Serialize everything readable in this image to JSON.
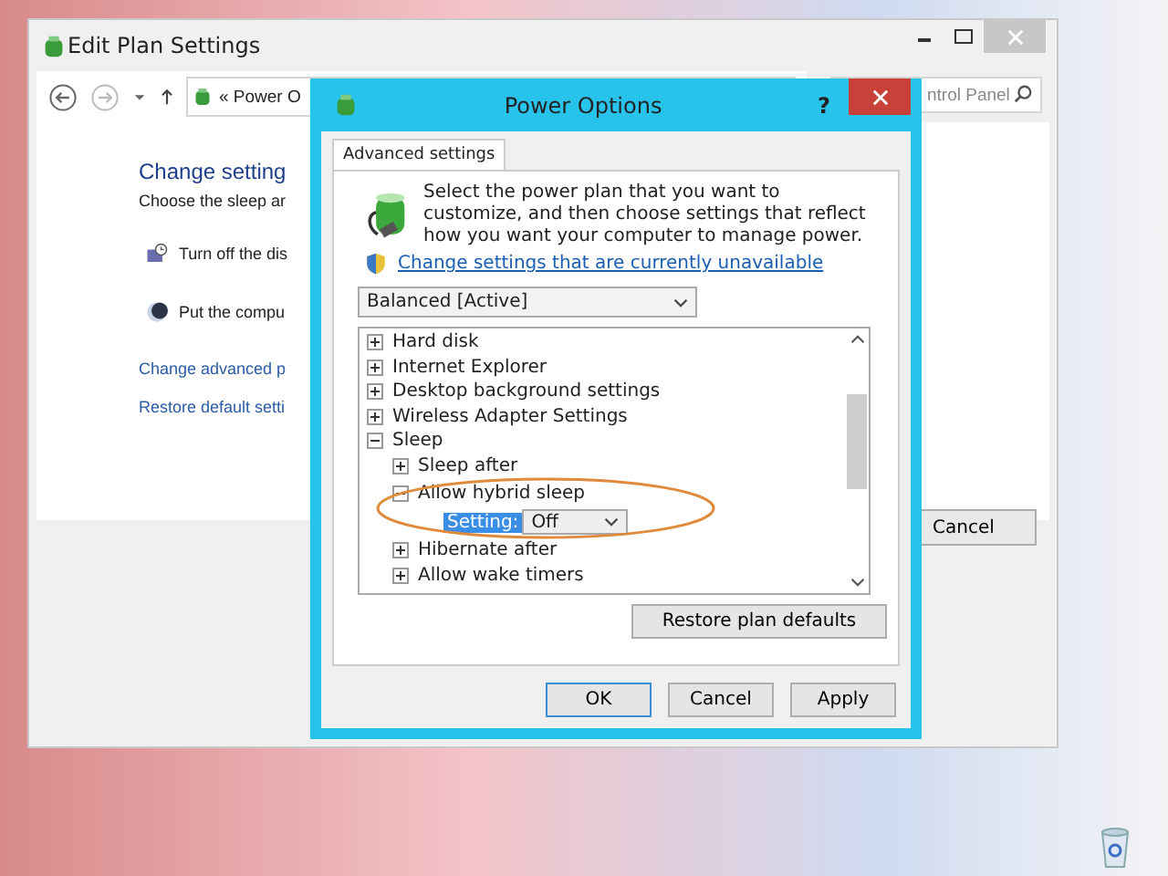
{
  "back_window": {
    "title": "Edit Plan Settings",
    "breadcrumb": "« Power O",
    "search": {
      "placeholder": "ntrol Panel"
    },
    "heading": "Change setting",
    "subtitle": "Choose the sleep ar",
    "settings": [
      {
        "kind": "display",
        "label": "Turn off the dis"
      },
      {
        "kind": "sleep",
        "label": "Put the compu"
      }
    ],
    "links": [
      "Change advanced p",
      "Restore default setti"
    ],
    "cancel_button": "Cancel"
  },
  "dialog": {
    "title": "Power Options",
    "help": "?",
    "tabs": [
      {
        "label": "Advanced settings",
        "selected": true
      }
    ],
    "intro": "Select the power plan that you want to customize, and then choose settings that reflect how you want your computer to manage power.",
    "unavailable_link": "Change settings that are currently unavailable",
    "plan": "Balanced [Active]",
    "tree": [
      {
        "label": "Hard disk",
        "expanded": false
      },
      {
        "label": "Internet Explorer",
        "expanded": false
      },
      {
        "label": "Desktop background settings",
        "expanded": false
      },
      {
        "label": "Wireless Adapter Settings",
        "expanded": false
      },
      {
        "label": "Sleep",
        "expanded": true,
        "children": [
          {
            "label": "Sleep after",
            "expanded": false
          },
          {
            "label": "Allow hybrid sleep",
            "expanded": true,
            "setting": {
              "label": "Setting:",
              "value": "Off"
            }
          },
          {
            "label": "Hibernate after",
            "expanded": false
          },
          {
            "label": "Allow wake timers",
            "expanded": false
          }
        ]
      }
    ],
    "restore_button": "Restore plan defaults",
    "buttons": [
      "OK",
      "Cancel",
      "Apply"
    ]
  }
}
